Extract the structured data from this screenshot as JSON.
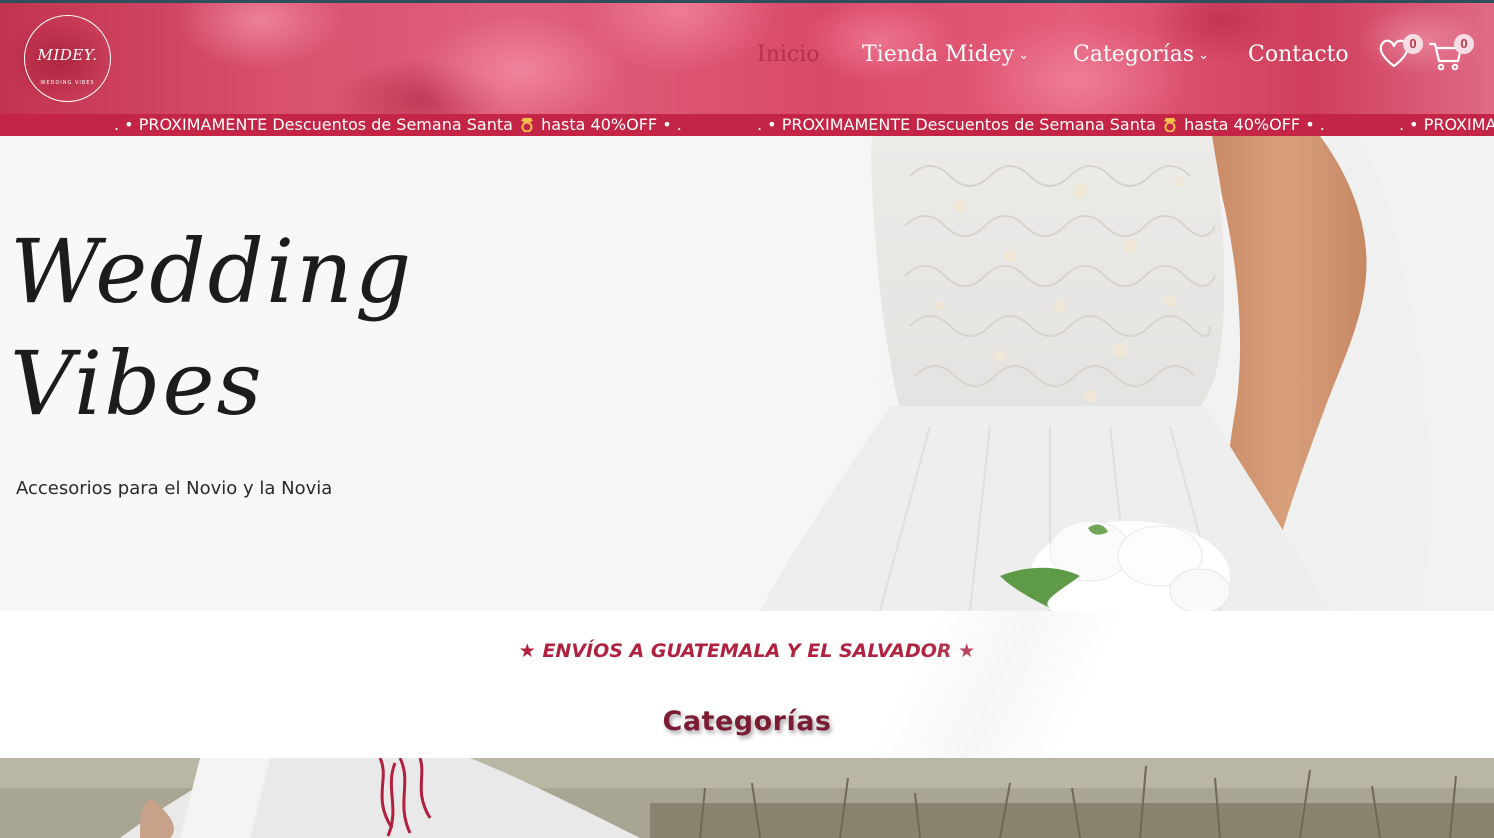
{
  "header": {
    "logo_text": "MIDEY.",
    "logo_subtext": "WEDDING VIBES",
    "nav": [
      {
        "label": "Inicio",
        "active": true,
        "has_dropdown": false
      },
      {
        "label": "Tienda Midey",
        "active": false,
        "has_dropdown": true
      },
      {
        "label": "Categorías",
        "active": false,
        "has_dropdown": true
      },
      {
        "label": "Contacto",
        "active": false,
        "has_dropdown": false
      }
    ],
    "wishlist_count": "0",
    "cart_count": "0",
    "icons": [
      "heart-icon",
      "cart-icon",
      "chevron-down-icon"
    ]
  },
  "ticker": {
    "items": [
      {
        "prefix": ". • PROXIMAMENTE Descuentos de Semana Santa",
        "suffix": "hasta 40%OFF • ."
      },
      {
        "prefix": ". • PROXIMAMENTE Descuentos de Semana Santa",
        "suffix": "hasta 40%OFF • ."
      },
      {
        "prefix": ". • PROXIMAMENTE",
        "suffix": ""
      }
    ],
    "icon": "ring-icon"
  },
  "hero": {
    "title_line1": "Wedding",
    "title_line2": "Vibes",
    "subtitle": "Accesorios para el Novio y la Novia"
  },
  "shipping_text": "★ ENVÍOS A GUATEMALA Y EL SALVADOR ★",
  "categories_title": "Categorías",
  "colors": {
    "brand": "#c42445",
    "accent_dark": "#7a1d33",
    "shipping_text": "#b0223f"
  }
}
